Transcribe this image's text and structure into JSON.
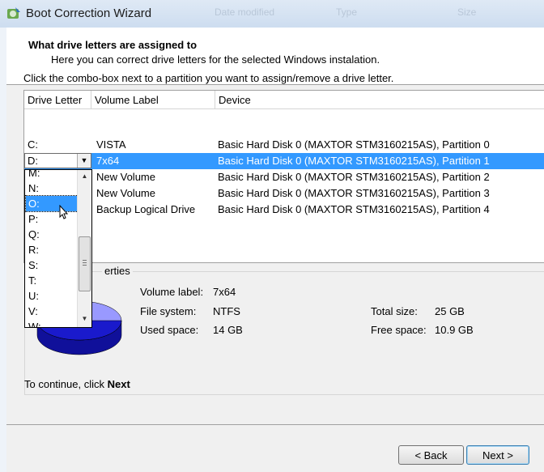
{
  "window": {
    "title": "Boot Correction Wizard",
    "ghost_headers": [
      "Date modified",
      "Type",
      "Size"
    ]
  },
  "header": {
    "title": "What drive letters are assigned to",
    "subtitle": "Here you can correct drive letters for the selected Windows instalation."
  },
  "instruction": "Click the combo-box next to a partition you want to assign/remove a drive letter.",
  "table": {
    "columns": [
      "Drive Letter",
      "Volume Label",
      "Device"
    ],
    "rows": [
      {
        "letter": "C:",
        "label": "VISTA",
        "device": "Basic Hard Disk 0 (MAXTOR STM3160215AS), Partition 0"
      },
      {
        "letter": "D:",
        "label": "7x64",
        "device": "Basic Hard Disk 0 (MAXTOR STM3160215AS), Partition 1"
      },
      {
        "letter": "",
        "label": "New Volume",
        "device": "Basic Hard Disk 0 (MAXTOR STM3160215AS), Partition 2"
      },
      {
        "letter": "",
        "label": "New Volume",
        "device": "Basic Hard Disk 0 (MAXTOR STM3160215AS), Partition 3"
      },
      {
        "letter": "",
        "label": "Backup Logical Drive",
        "device": "Basic Hard Disk 0 (MAXTOR STM3160215AS), Partition 4"
      }
    ],
    "selected_row": 1
  },
  "dropdown": {
    "options": [
      "M:",
      "N:",
      "O:",
      "P:",
      "Q:",
      "R:",
      "S:",
      "T:",
      "U:",
      "V:",
      "W:"
    ],
    "highlighted": "O:"
  },
  "properties": {
    "title_visible": "erties",
    "volume_label_key": "Volume label:",
    "volume_label_val": "7x64",
    "file_system_key": "File system:",
    "file_system_val": "NTFS",
    "used_space_key": "Used space:",
    "used_space_val": "14 GB",
    "total_size_key": "Total size:",
    "total_size_val": "25 GB",
    "free_space_key": "Free space:",
    "free_space_val": "10.9 GB",
    "used_fraction": 0.564
  },
  "footer": {
    "prefix": "To continue, click ",
    "bold": "Next"
  },
  "buttons": {
    "back": "< Back",
    "next": "Next >"
  },
  "colors": {
    "selection": "#3399ff",
    "pie_used": "#1a1acc",
    "pie_free": "#9999ff"
  }
}
